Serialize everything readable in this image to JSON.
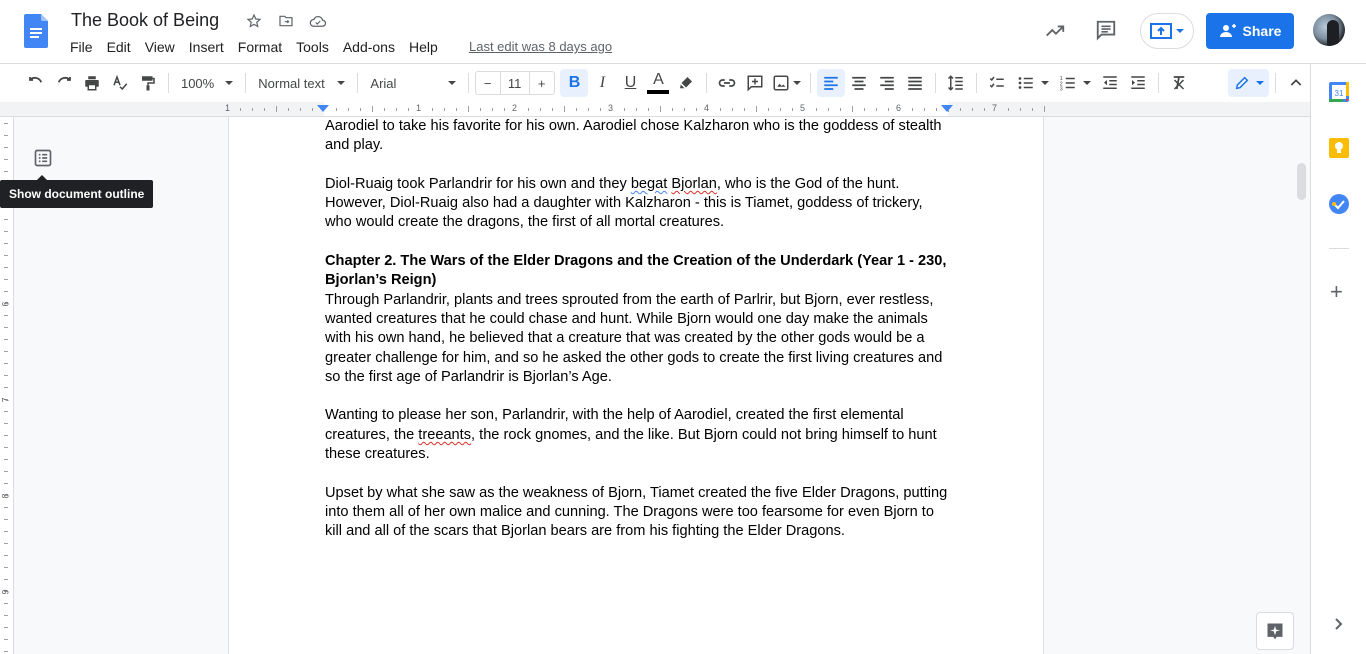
{
  "document": {
    "title": "The Book of Being",
    "last_edit": "Last edit was 8 days ago"
  },
  "menu": [
    "File",
    "Edit",
    "View",
    "Insert",
    "Format",
    "Tools",
    "Add-ons",
    "Help"
  ],
  "header": {
    "share_label": "Share",
    "icons": [
      "star-icon",
      "move-to-folder-icon",
      "cloud-saved-icon",
      "activity-trend-icon",
      "comments-icon",
      "present-icon"
    ]
  },
  "toolbar": {
    "zoom": "100%",
    "style": "Normal text",
    "font": "Arial",
    "font_size": "11",
    "minus": "−",
    "plus": "+",
    "bold": "B",
    "italic": "I",
    "underline": "U",
    "text_color_label": "A",
    "text_color": "#000000"
  },
  "ruler": {
    "labels": [
      "1",
      "1",
      "2",
      "3",
      "4",
      "5",
      "6",
      "7"
    ]
  },
  "vruler": {
    "labels": [
      "6",
      "7",
      "8",
      "9"
    ]
  },
  "outline": {
    "tooltip": "Show document outline"
  },
  "body": {
    "p1": "Aarodiel to take his favorite for his own. Aarodiel chose Kalzharon who is the goddess of stealth and play.",
    "p2_a": "Diol-Ruaig took Parlandrir for his own and they ",
    "p2_grammar": "begat",
    "p2_b": " ",
    "p2_spell": "Bjorlan",
    "p2_c": ", who is the God of the hunt. However, Diol-Ruaig also had a daughter with Kalzharon - this is Tiamet, goddess of trickery, who would create the dragons, the first of all mortal creatures.",
    "heading": "Chapter 2. The Wars of the Elder Dragons and the Creation of the Underdark (Year 1 - 230, Bjorlan’s Reign)",
    "p3": "Through Parlandrir, plants and trees sprouted from the earth of Parlrir, but Bjorn, ever restless, wanted creatures that he could chase and hunt. While Bjorn would one day make the animals with his own hand, he believed that a creature that was created by the other gods would be a greater challenge for him, and so he asked the other gods to create the first living creatures and so the first age of Parlandrir is Bjorlan’s Age.",
    "p4_a": "Wanting to please her son, Parlandrir, with the help of Aarodiel, created the first elemental creatures, the ",
    "p4_spell": "treeants",
    "p4_b": ", the rock gnomes, and the like. But Bjorn could not bring himself to hunt these creatures.",
    "p5": "Upset by what she saw as the weakness of Bjorn, Tiamet created the five Elder Dragons, putting into them all of her own malice and cunning. The Dragons were too fearsome for even Bjorn to kill and all of the scars that Bjorlan bears are from his fighting the Elder Dragons."
  },
  "sidepanel": {
    "calendar_day": "31",
    "items": [
      "calendar-icon",
      "keep-icon",
      "tasks-icon",
      "get-addons-icon"
    ]
  },
  "colors": {
    "accent": "#1a73e8",
    "docs_blue": "#4285f4",
    "spell_error": "#d93025"
  }
}
